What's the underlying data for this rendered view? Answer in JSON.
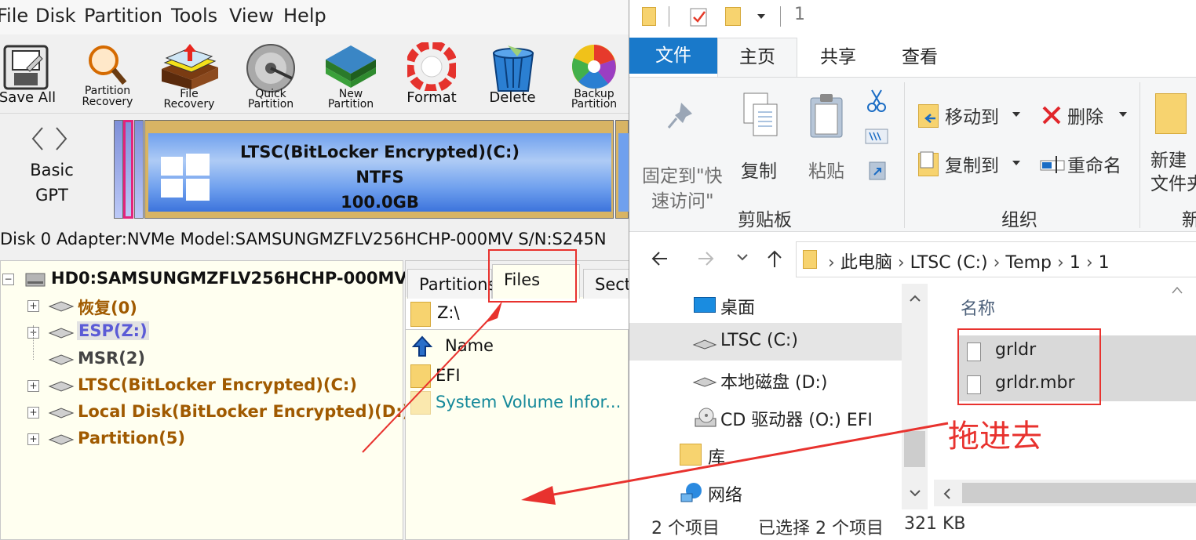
{
  "left_app": {
    "menu": [
      "File",
      "Disk",
      "Partition",
      "Tools",
      "View",
      "Help"
    ],
    "toolbar": [
      {
        "label1": "Save All",
        "label2": "",
        "icon": "save-all-icon"
      },
      {
        "label1": "Partition",
        "label2": "Recovery",
        "icon": "partition-recovery-icon"
      },
      {
        "label1": "File",
        "label2": "Recovery",
        "icon": "file-recovery-icon"
      },
      {
        "label1": "Quick",
        "label2": "Partition",
        "icon": "quick-partition-icon"
      },
      {
        "label1": "New",
        "label2": "Partition",
        "icon": "new-partition-icon"
      },
      {
        "label1": "Format",
        "label2": "",
        "icon": "format-icon"
      },
      {
        "label1": "Delete",
        "label2": "",
        "icon": "delete-icon"
      },
      {
        "label1": "Backup",
        "label2": "Partition",
        "icon": "backup-partition-icon"
      }
    ],
    "disk_map": {
      "disk_type1": "Basic",
      "disk_type2": "GPT",
      "partition_name": "LTSC(BitLocker Encrypted)(C:)",
      "partition_fs": "NTFS",
      "partition_size": "100.0GB"
    },
    "adapter_info": "Disk 0 Adapter:NVMe  Model:SAMSUNGMZFLV256HCHP-000MV  S/N:S245N",
    "tree": {
      "root": "HD0:SAMSUNGMZFLV256HCHP-000MV",
      "items": [
        {
          "label": "恢复(0)",
          "color": "#a05a00"
        },
        {
          "label": "ESP(Z:)",
          "color": "#5b5bd6"
        },
        {
          "label": "MSR(2)",
          "color": "#444444"
        },
        {
          "label": "LTSC(BitLocker Encrypted)(C:)",
          "color": "#a05a00"
        },
        {
          "label": "Local Disk(BitLocker Encrypted)(D:)",
          "color": "#a05a00"
        },
        {
          "label": "Partition(5)",
          "color": "#a05a00"
        }
      ]
    },
    "tabs": [
      "Partitions",
      "Files",
      "Sect"
    ],
    "path": "Z:\\",
    "file_header": "Name",
    "files": [
      "EFI",
      "System Volume Infor..."
    ]
  },
  "explorer": {
    "qat_number": "1",
    "tabs": [
      "文件",
      "主页",
      "共享",
      "查看"
    ],
    "ribbon": {
      "pin_label_1": "固定到\"快",
      "pin_label_2": "速访问\"",
      "copy": "复制",
      "paste": "粘贴",
      "clipboard_group": "剪贴板",
      "move_to": "移动到",
      "copy_to": "复制到",
      "delete": "删除",
      "rename": "重命名",
      "organize_group": "组织",
      "new_folder_1": "新建",
      "new_folder_2": "文件夹",
      "new_group": "新"
    },
    "address": [
      "此电脑",
      "LTSC (C:)",
      "Temp",
      "1",
      "1"
    ],
    "nav": [
      "桌面",
      "LTSC (C:)",
      "本地磁盘 (D:)",
      "CD 驱动器 (O:) EFI",
      "库",
      "网络"
    ],
    "column_name": "名称",
    "files": [
      "grldr",
      "grldr.mbr"
    ],
    "status": {
      "count": "2 个项目",
      "selected": "已选择 2 个项目",
      "size": "321 KB"
    }
  },
  "annotation": "拖进去",
  "colors": {
    "accent_blue": "#1979ca",
    "tree_orange": "#a05a00",
    "annotation_red": "#e8322e",
    "selection": "#cce8ff"
  }
}
